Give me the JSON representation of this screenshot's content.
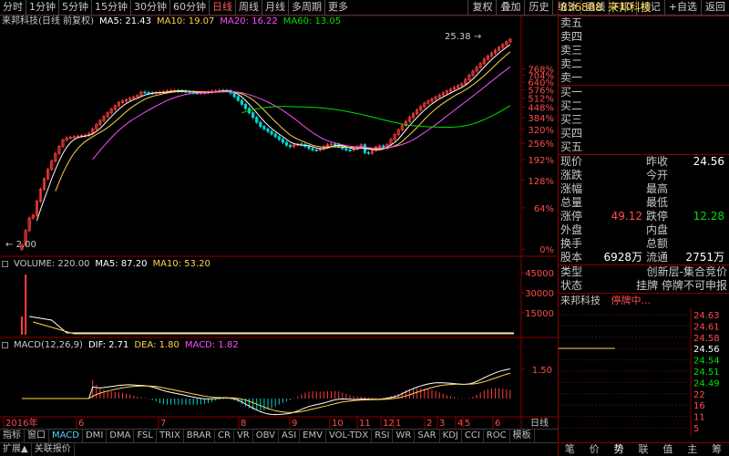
{
  "toolbar": {
    "periods": [
      "分时",
      "1分钟",
      "5分钟",
      "15分钟",
      "30分钟",
      "60分钟",
      "日线",
      "周线",
      "月线",
      "多周期",
      "更多"
    ],
    "active_period": "日线",
    "right_buttons": [
      "复权",
      "叠加",
      "历史",
      "统计",
      "画线",
      "F10",
      "标记",
      "+自选",
      "返回"
    ]
  },
  "main": {
    "title": "来邦科技(日线 前复权)",
    "ma": [
      {
        "label": "MA5: 21.43",
        "color": "#ffffff"
      },
      {
        "label": "MA10: 19.07",
        "color": "#ffd24c"
      },
      {
        "label": "MA20: 16.22",
        "color": "#ff4cff"
      },
      {
        "label": "MA60: 13.05",
        "color": "#00e000"
      }
    ],
    "high_label": "25.38",
    "low_label": "2.00",
    "pct_ticks": [
      "768%",
      "704%",
      "640%",
      "576%",
      "512%",
      "448%",
      "384%",
      "320%",
      "256%",
      "192%",
      "128%",
      "64%",
      "0%"
    ]
  },
  "volume": {
    "title": "VOLUME: 220.00",
    "ma5": "MA5: 87.20",
    "ma10": "MA10: 53.20",
    "ticks": [
      "45000",
      "30000",
      "15000"
    ]
  },
  "macd": {
    "title": "MACD(12,26,9)",
    "dif": "DIF: 2.71",
    "dea": "DEA: 1.80",
    "macd": "MACD: 1.82",
    "tick": "1.50"
  },
  "xaxis": {
    "labels": [
      "2016年",
      "6",
      "7",
      "8",
      "9",
      "10",
      "11",
      "12",
      "1",
      "2",
      "3",
      "4",
      "5",
      "6"
    ],
    "period": "日线"
  },
  "tabs": [
    "指标",
    "窗口",
    "MACD",
    "DMI",
    "DMA",
    "FSL",
    "TRIX",
    "BRAR",
    "CR",
    "VR",
    "OBV",
    "ASI",
    "EMV",
    "VOL-TDX",
    "RSI",
    "WR",
    "SAR",
    "KDJ",
    "CCI",
    "ROC",
    "模板"
  ],
  "bottom": [
    "扩展▲",
    "关联报价"
  ],
  "quote": {
    "code": "836888",
    "name": "来邦科技",
    "sell": [
      "卖五",
      "卖四",
      "卖三",
      "卖二",
      "卖一"
    ],
    "buy": [
      "买一",
      "买二",
      "买三",
      "买四",
      "买五"
    ],
    "stats": [
      {
        "k": "现价",
        "v": "",
        "k2": "昨收",
        "v2": "24.56",
        "c2": "#ffffff"
      },
      {
        "k": "涨跌",
        "v": "",
        "k2": "今开",
        "v2": "",
        "c2": "#ffffff"
      },
      {
        "k": "涨幅",
        "v": "",
        "k2": "最高",
        "v2": "",
        "c2": "#ffffff"
      },
      {
        "k": "总量",
        "v": "",
        "k2": "最低",
        "v2": "",
        "c2": "#ffffff"
      },
      {
        "k": "涨停",
        "v": "49.12",
        "c": "#ff4c4c",
        "k2": "跌停",
        "v2": "12.28",
        "c2": "#00e000"
      },
      {
        "k": "外盘",
        "v": "",
        "k2": "内盘",
        "v2": "",
        "c2": "#ffffff"
      },
      {
        "k": "换手",
        "v": "",
        "k2": "总额",
        "v2": "",
        "c2": "#ffffff"
      },
      {
        "k": "股本",
        "v": "6928万",
        "c": "#ffffff",
        "k2": "流通",
        "v2": "2751万",
        "c2": "#ffffff"
      }
    ],
    "type_label": "类型",
    "type_value": "创新层-集合竞价",
    "status_label": "状态",
    "status_value": "挂牌  停牌不可申报",
    "mini_title": "来邦科技",
    "mini_status": "停牌中...",
    "mini_ticks": [
      "24.63",
      "24.61",
      "24.58",
      "24.56",
      "24.54",
      "24.51",
      "24.49",
      "22",
      "16",
      "11",
      "5"
    ]
  },
  "rbottom": [
    "笔",
    "价",
    "势",
    "联",
    "值",
    "主",
    "筹"
  ],
  "rbottom_active": "势",
  "chart_data": {
    "type": "line",
    "title": "来邦科技(日线 前复权)",
    "x": [
      "2016-05",
      "2016-06",
      "2016-07",
      "2016-08",
      "2016-09",
      "2016-10",
      "2016-11",
      "2016-12",
      "2017-01",
      "2017-02",
      "2017-03",
      "2017-04",
      "2017-05",
      "2017-06"
    ],
    "series": [
      {
        "name": "MA5",
        "values": [
          4,
          7,
          9,
          12,
          10,
          9,
          9,
          9,
          10,
          10,
          14,
          19,
          21.4
        ]
      },
      {
        "name": "MA10",
        "values": [
          3,
          6,
          9,
          12,
          10,
          9,
          9,
          9,
          9,
          10,
          13,
          17,
          19.1
        ]
      },
      {
        "name": "MA20",
        "values": [
          3,
          5,
          8,
          12,
          11,
          10,
          9,
          9,
          9,
          9,
          12,
          15,
          16.2
        ]
      },
      {
        "name": "MA60",
        "values": [
          null,
          null,
          null,
          10,
          10,
          10.5,
          10.5,
          10.5,
          10.5,
          10,
          10,
          12,
          13.1
        ]
      }
    ],
    "y_high": 25.38,
    "y_low": 2.0,
    "ylabel_ticks": [
      "768%",
      "704%",
      "640%",
      "576%",
      "512%",
      "448%",
      "384%",
      "320%",
      "256%",
      "192%",
      "128%",
      "64%",
      "0%"
    ]
  }
}
